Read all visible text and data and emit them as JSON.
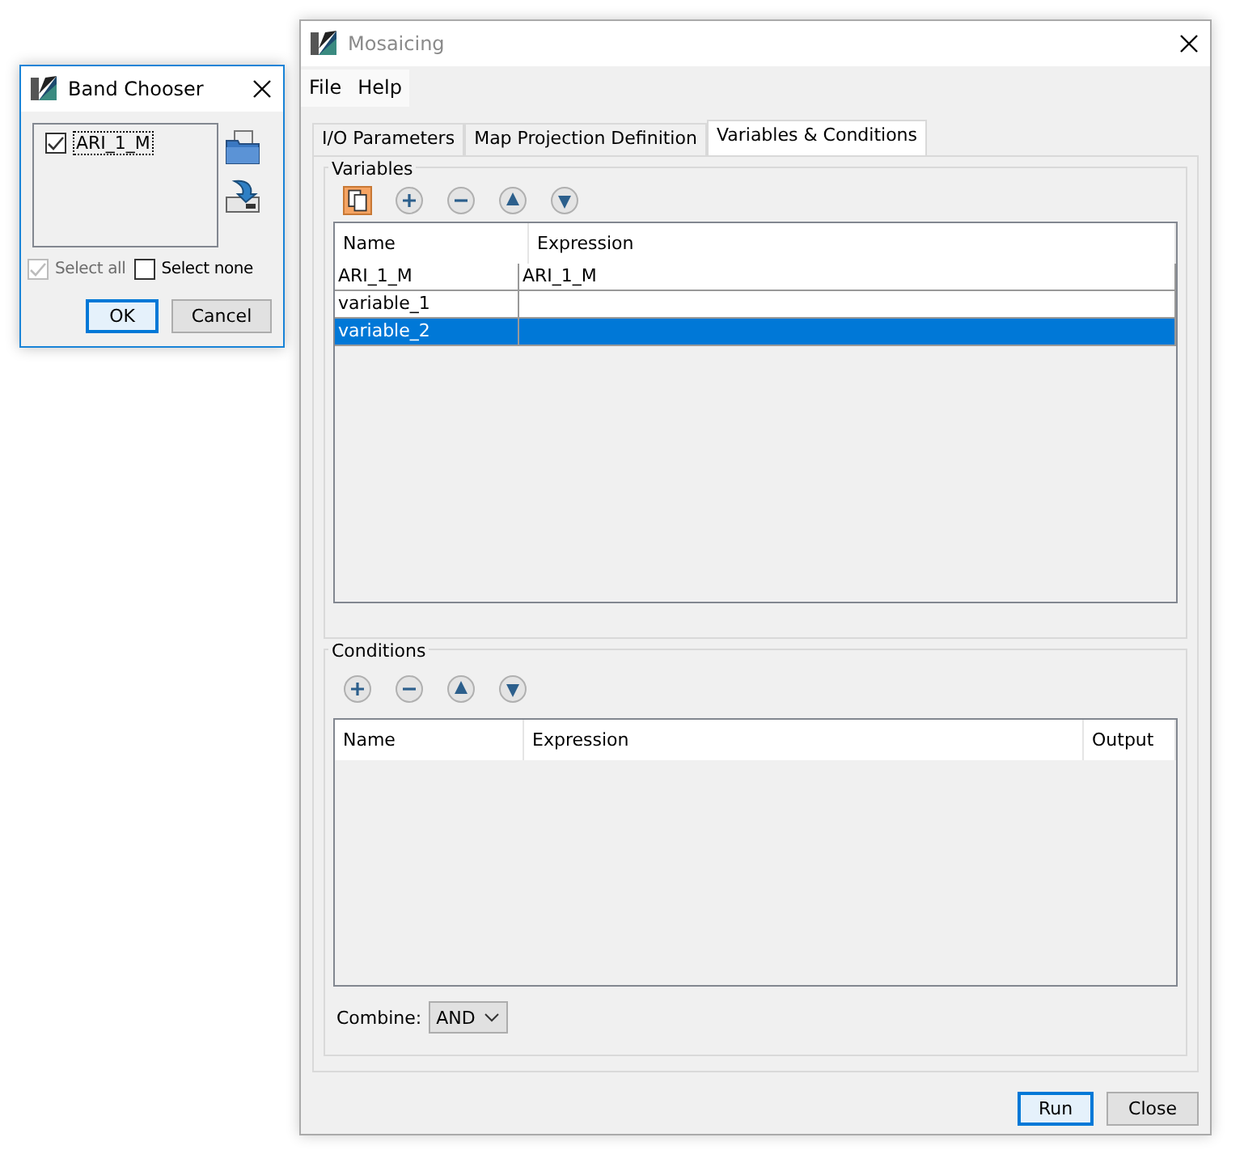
{
  "band_chooser": {
    "title": "Band Chooser",
    "bands": [
      {
        "name": "ARI_1_M",
        "checked": true
      }
    ],
    "select_all": {
      "label": "Select all",
      "checked": true,
      "disabled": true
    },
    "select_none": {
      "label": "Select none",
      "checked": false,
      "disabled": false
    },
    "buttons": [
      {
        "label": "OK",
        "default": true
      },
      {
        "label": "Cancel",
        "default": false
      }
    ]
  },
  "mosaicing": {
    "title": "Mosaicing",
    "menu": [
      "File",
      "Help"
    ],
    "tabs": [
      {
        "label": "I/O Parameters",
        "selected": false
      },
      {
        "label": "Map Projection Definition",
        "selected": false
      },
      {
        "label": "Variables & Conditions",
        "selected": true
      }
    ],
    "variables": {
      "title": "Variables",
      "columns": [
        "Name",
        "Expression"
      ],
      "rows": [
        {
          "cells": [
            "ARI_1_M",
            "ARI_1_M"
          ],
          "selected": false
        },
        {
          "cells": [
            "variable_1",
            ""
          ],
          "selected": false
        },
        {
          "cells": [
            "variable_2",
            ""
          ],
          "selected": true
        }
      ]
    },
    "conditions": {
      "title": "Conditions",
      "columns": [
        "Name",
        "Expression",
        "Output"
      ]
    },
    "combine": {
      "label": "Combine:",
      "value": "AND"
    },
    "buttons": [
      {
        "label": "Run",
        "default": true
      },
      {
        "label": "Close",
        "default": false
      }
    ]
  }
}
